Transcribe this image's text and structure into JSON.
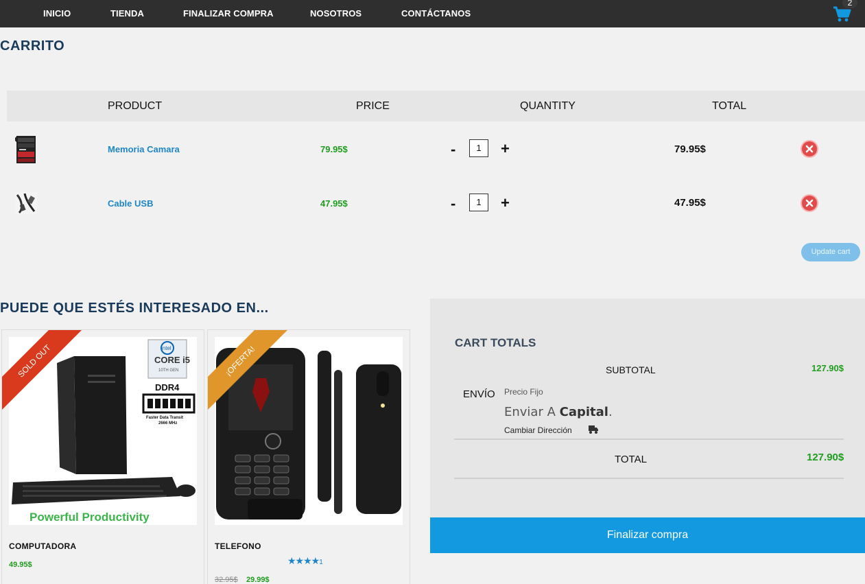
{
  "nav": {
    "items": [
      "INICIO",
      "TIENDA",
      "FINALIZAR COMPRA",
      "NOSOTROS",
      "CONTÁCTANOS"
    ],
    "cart_count": "2",
    "cart_icon": "shopping-cart-icon"
  },
  "page_title": "CARRITO",
  "table": {
    "headers": {
      "product": "PRODUCT",
      "price": "PRICE",
      "quantity": "QUANTITY",
      "total": "TOTAL"
    },
    "rows": [
      {
        "name": "Memoria Camara",
        "price": "79.95$",
        "qty": "1",
        "total": "79.95$",
        "thumb_icon": "sd-card-thumbnail"
      },
      {
        "name": "Cable USB",
        "price": "47.95$",
        "qty": "1",
        "total": "47.95$",
        "thumb_icon": "usb-cable-thumbnail"
      }
    ],
    "qty_minus": "-",
    "qty_plus": "+",
    "update_label": "Update cart"
  },
  "suggestions": {
    "title": "PUEDE QUE ESTÉS INTERESADO EN...",
    "items": [
      {
        "ribbon": "SOLD OUT",
        "ribbon_color": "#d93a1e",
        "name": "COMPUTADORA",
        "price": "49.95$",
        "image_text_brand": "intel",
        "image_text_chip": "CORE i5",
        "image_text_gen": "10TH GEN",
        "image_text_ram": "DDR4",
        "image_text_ram_sub": "Faster Data Transit",
        "image_text_ram_speed": "2666 MHz",
        "image_text_caption": "Powerful Productivity"
      },
      {
        "ribbon": "¡OFERTA!",
        "ribbon_color": "#e0962a",
        "name": "TELEFONO",
        "old_price": "32.95$",
        "price": "29.99$",
        "stars": "★★★★",
        "rating_tail": "1",
        "rating": 4
      }
    ]
  },
  "totals": {
    "title": "CART TOTALS",
    "subtotal_label": "SUBTOTAL",
    "subtotal_value": "127.90$",
    "shipping_label": "ENVÍO",
    "shipping_method": "Precio Fijo",
    "ship_to_prefix": "Enviar A",
    "ship_to_place": "Capital",
    "ship_to_suffix": ".",
    "change_address": "Cambiar Dirección",
    "total_label": "TOTAL",
    "total_value": "127.90$"
  },
  "checkout_label": "Finalizar compra",
  "colors": {
    "accent": "#1399df",
    "price_green": "#1e9d1e",
    "link_blue": "#1f86c6",
    "remove_red": "#e14b4b"
  }
}
